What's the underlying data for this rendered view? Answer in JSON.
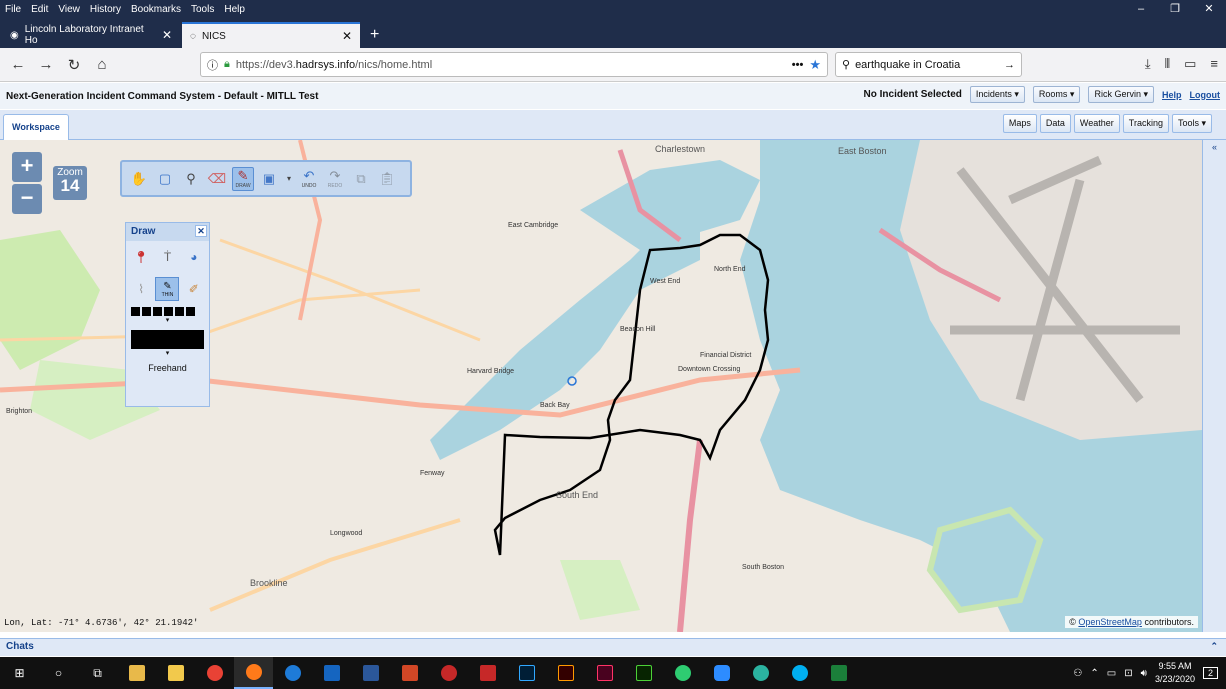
{
  "menubar": [
    "File",
    "Edit",
    "View",
    "History",
    "Bookmarks",
    "Tools",
    "Help"
  ],
  "window_controls": [
    "–",
    "❐",
    "✕"
  ],
  "tabs": [
    {
      "title": "Lincoln Laboratory Intranet Ho",
      "active": false
    },
    {
      "title": "NICS",
      "active": true
    }
  ],
  "new_tab": "+",
  "nav": {
    "back": "←",
    "forward": "→",
    "reload": "↻",
    "home": "⌂",
    "url_prefix": "https://dev3.",
    "url_domain": "hadrsys.info",
    "url_path": "/nics/home.html",
    "menu_dots": "•••",
    "star": "★",
    "search_value": "earthquake in Croatia",
    "search_go": "→",
    "right_icons": [
      "⤓",
      "⫴",
      "▭",
      "≡"
    ]
  },
  "app": {
    "title": "Next-Generation Incident Command System - Default - MITLL Test",
    "incident_status": "No Incident Selected",
    "incidents_btn": "Incidents ▾",
    "rooms_btn": "Rooms ▾",
    "user_btn": "Rick Gervin ▾",
    "help_link": "Help",
    "logout_link": "Logout"
  },
  "workspace_tab": "Workspace",
  "right_tabs": [
    "Maps",
    "Data",
    "Weather",
    "Tracking",
    "Tools ▾"
  ],
  "map": {
    "zoom_in": "+",
    "zoom_out": "−",
    "zoom_label": "Zoom",
    "zoom_value": "14",
    "coords": "Lon, Lat: -71° 4.6736', 42° 21.1942'",
    "attribution_prefix": "©",
    "attribution_link": "OpenStreetMap",
    "attribution_suffix": "contributors.",
    "labels": [
      {
        "text": "Charlestown",
        "cls": "big"
      },
      {
        "text": "East Boston",
        "cls": "big"
      },
      {
        "text": "East Cambridge",
        "cls": ""
      },
      {
        "text": "North End",
        "cls": ""
      },
      {
        "text": "West End",
        "cls": ""
      },
      {
        "text": "Beacon Hill",
        "cls": ""
      },
      {
        "text": "Financial District",
        "cls": ""
      },
      {
        "text": "Downtown Crossing",
        "cls": ""
      },
      {
        "text": "Back Bay",
        "cls": ""
      },
      {
        "text": "South End",
        "cls": "big"
      },
      {
        "text": "Fenway",
        "cls": ""
      },
      {
        "text": "South Boston",
        "cls": ""
      },
      {
        "text": "Brookline",
        "cls": "big"
      },
      {
        "text": "Brighton",
        "cls": ""
      },
      {
        "text": "Harvard Bridge",
        "cls": ""
      },
      {
        "text": "Longwood",
        "cls": ""
      }
    ]
  },
  "toolbar": {
    "draw_small": "DRAW",
    "undo_small": "UNDO",
    "redo_small": "REDO"
  },
  "draw_panel": {
    "title": "Draw",
    "close": "✕",
    "thick_label": "THIN",
    "mode": "Freehand"
  },
  "chats": {
    "title": "Chats",
    "expand": "⌃"
  },
  "taskbar": {
    "time": "9:55 AM",
    "date": "3/23/2020",
    "notif": "2",
    "apps": [
      {
        "name": "start",
        "color": "#ffffff"
      },
      {
        "name": "cortana",
        "color": "#ffffff"
      },
      {
        "name": "taskview",
        "color": "#ffffff"
      },
      {
        "name": "explorer",
        "color": "#e8b94a"
      },
      {
        "name": "notes",
        "color": "#f2c94c"
      },
      {
        "name": "chrome",
        "color": "#e94235"
      },
      {
        "name": "firefox",
        "color": "#ff7a1a"
      },
      {
        "name": "edge",
        "color": "#1e7bd8"
      },
      {
        "name": "outlook",
        "color": "#1565c0"
      },
      {
        "name": "word",
        "color": "#2b579a"
      },
      {
        "name": "powerpoint",
        "color": "#d24726"
      },
      {
        "name": "app-red",
        "color": "#c62828"
      },
      {
        "name": "acrobat",
        "color": "#c62828"
      },
      {
        "name": "photoshop",
        "color": "#31a8ff"
      },
      {
        "name": "illustrator",
        "color": "#ff9a00"
      },
      {
        "name": "indesign",
        "color": "#ff3366"
      },
      {
        "name": "dreamweaver",
        "color": "#4cd137"
      },
      {
        "name": "app-green",
        "color": "#2ecc71"
      },
      {
        "name": "zoom",
        "color": "#2d8cff"
      },
      {
        "name": "app-teal",
        "color": "#2bb3a0"
      },
      {
        "name": "skype",
        "color": "#00aff0"
      },
      {
        "name": "app-dollar",
        "color": "#1b7f3a"
      }
    ]
  }
}
